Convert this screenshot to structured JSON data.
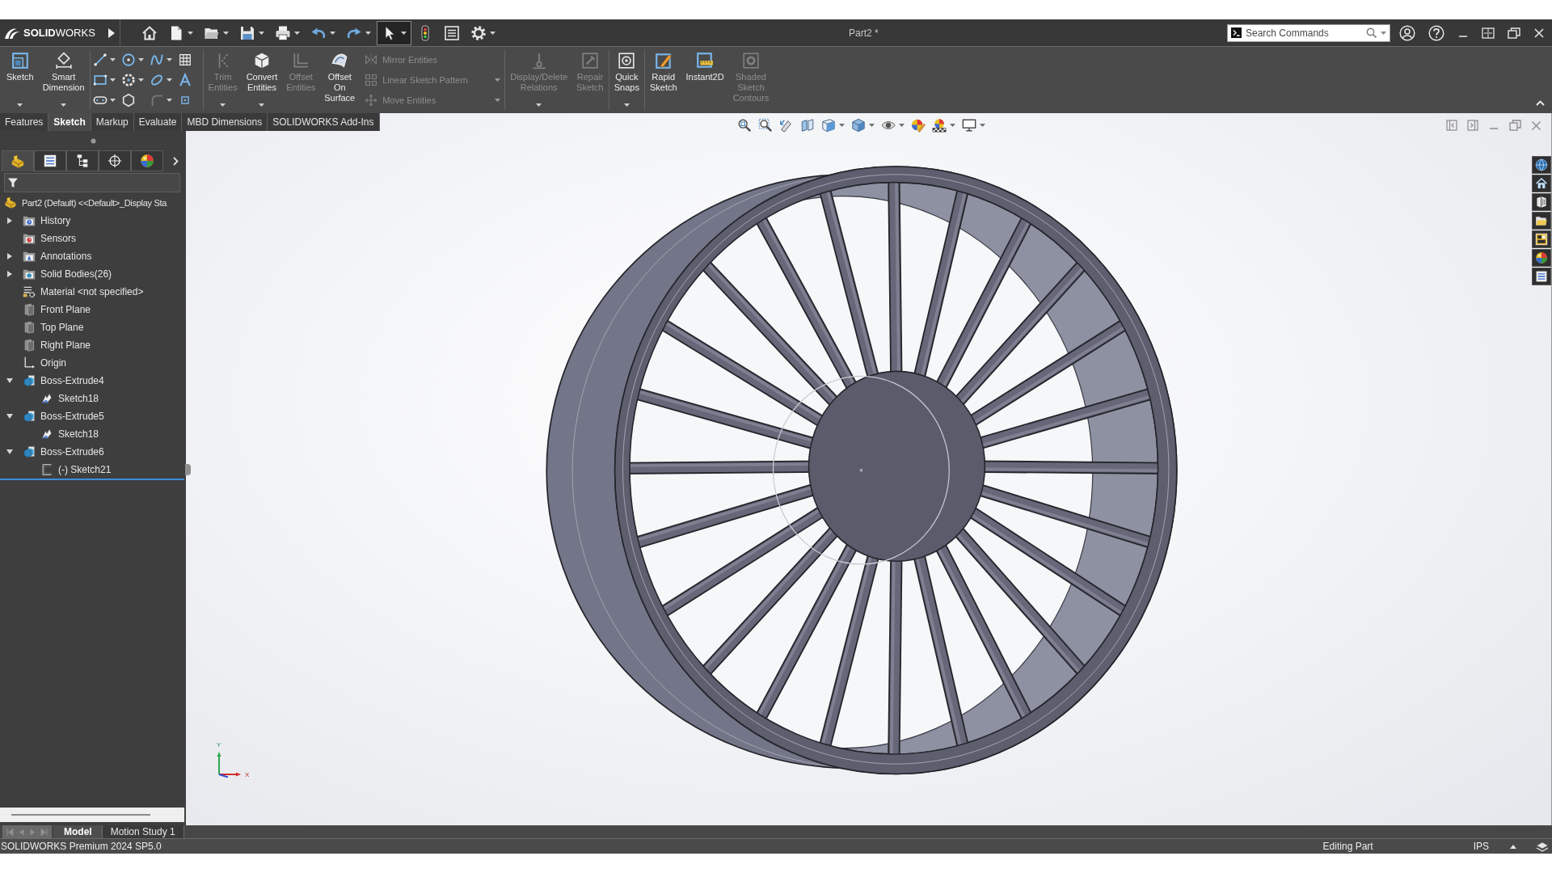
{
  "title_bar": {
    "logo": "**SOLID**WORKS",
    "quick_access": [
      {
        "kind": "home",
        "dropdown": false,
        "pressed": false
      },
      {
        "kind": "new",
        "dropdown": true,
        "pressed": false
      },
      {
        "kind": "open",
        "dropdown": true,
        "pressed": false
      },
      {
        "kind": "save",
        "dropdown": true,
        "pressed": false
      },
      {
        "kind": "print",
        "dropdown": true,
        "pressed": false
      },
      {
        "kind": "undo",
        "dropdown": true,
        "pressed": false
      },
      {
        "kind": "redo",
        "dropdown": true,
        "pressed": false
      },
      {
        "kind": "select",
        "dropdown": true,
        "pressed": true
      },
      {
        "kind": "rebuild",
        "dropdown": false,
        "pressed": false
      },
      {
        "kind": "properties",
        "dropdown": false,
        "pressed": false
      },
      {
        "kind": "options",
        "dropdown": true,
        "pressed": false
      }
    ],
    "document_title": "Part2 *",
    "search": {
      "placeholder": "Search Commands"
    }
  },
  "ribbon": {
    "sections": [
      {
        "groups": [
          {
            "kind": "large",
            "tools": [
              {
                "kind": "sketch",
                "label": "Sketch",
                "enabled": true,
                "dropdown": true
              },
              {
                "kind": "dimension",
                "label": "Smart Dimension",
                "enabled": true,
                "dropdown": true
              }
            ]
          }
        ]
      },
      {
        "groups": [
          {
            "kind": "grid",
            "tools": [
              {
                "kind": "line",
                "enabled": true,
                "dropdown": true
              },
              {
                "kind": "circle",
                "enabled": true,
                "dropdown": true
              },
              {
                "kind": "spline",
                "enabled": true,
                "dropdown": true
              },
              {
                "kind": "mesh",
                "enabled": true,
                "dropdown": false
              },
              {
                "kind": "rectangle",
                "enabled": true,
                "dropdown": true
              },
              {
                "kind": "arc",
                "enabled": true,
                "dropdown": true
              },
              {
                "kind": "ellipse",
                "enabled": true,
                "dropdown": true
              },
              {
                "kind": "text",
                "enabled": true,
                "dropdown": false
              },
              {
                "kind": "slot",
                "enabled": true,
                "dropdown": true
              },
              {
                "kind": "polygon",
                "enabled": true,
                "dropdown": false
              },
              {
                "kind": "fillet",
                "enabled": false,
                "dropdown": true
              },
              {
                "kind": "point",
                "enabled": true,
                "dropdown": false
              }
            ]
          }
        ]
      },
      {
        "groups": [
          {
            "kind": "large",
            "tools": [
              {
                "kind": "trim",
                "label": "Trim Entities",
                "enabled": false,
                "dropdown": true
              },
              {
                "kind": "convert",
                "label": "Convert Entities",
                "enabled": true,
                "dropdown": true
              },
              {
                "kind": "offset",
                "label": "Offset Entities",
                "enabled": false,
                "dropdown": false
              },
              {
                "kind": "surface",
                "label": "Offset On Surface",
                "enabled": true,
                "dropdown": false
              }
            ]
          },
          {
            "kind": "list",
            "tools": [
              {
                "kind": "mirror",
                "label": "Mirror Entities",
                "enabled": false,
                "dropdown": false
              },
              {
                "kind": "pattern",
                "label": "Linear Sketch Pattern",
                "enabled": false,
                "dropdown": true
              },
              {
                "kind": "move",
                "label": "Move Entities",
                "enabled": false,
                "dropdown": true
              }
            ]
          }
        ]
      },
      {
        "groups": [
          {
            "kind": "large",
            "tools": [
              {
                "kind": "relations",
                "label": "Display/Delete Relations",
                "enabled": false,
                "dropdown": true
              },
              {
                "kind": "repair",
                "label": "Repair Sketch",
                "enabled": false,
                "dropdown": false
              }
            ]
          }
        ]
      },
      {
        "groups": [
          {
            "kind": "large",
            "tools": [
              {
                "kind": "snaps",
                "label": "Quick Snaps",
                "enabled": true,
                "dropdown": true
              }
            ]
          }
        ]
      },
      {
        "groups": [
          {
            "kind": "large",
            "tools": [
              {
                "kind": "rapid",
                "label": "Rapid Sketch",
                "enabled": true,
                "dropdown": false
              },
              {
                "kind": "instant",
                "label": "Instant2D",
                "enabled": true,
                "dropdown": false
              },
              {
                "kind": "contours",
                "label": "Shaded Sketch Contours",
                "enabled": false,
                "dropdown": false
              }
            ]
          }
        ]
      }
    ]
  },
  "command_tabs": [
    {
      "label": "Features",
      "selected": false
    },
    {
      "label": "Sketch",
      "selected": true
    },
    {
      "label": "Markup",
      "selected": false
    },
    {
      "label": "Evaluate",
      "selected": false
    },
    {
      "label": "MBD Dimensions",
      "selected": false
    },
    {
      "label": "SOLIDWORKS Add-Ins",
      "selected": false
    }
  ],
  "feature_manager": {
    "panel_tabs": [
      {
        "kind": "tree",
        "selected": true
      },
      {
        "kind": "property",
        "selected": false
      },
      {
        "kind": "config",
        "selected": false
      },
      {
        "kind": "dimxpert",
        "selected": false
      },
      {
        "kind": "display",
        "selected": false
      }
    ],
    "tree": [
      {
        "kind": "part",
        "label": "Part2 (Default) <<Default>_Display Sta",
        "children": [
          {
            "kind": "history",
            "label": "History",
            "expanded": false
          },
          {
            "kind": "sensors",
            "label": "Sensors"
          },
          {
            "kind": "annotations",
            "label": "Annotations",
            "expanded": false
          },
          {
            "kind": "bodies",
            "label": "Solid Bodies(26)",
            "expanded": false
          },
          {
            "kind": "material",
            "label": "Material <not specified>"
          },
          {
            "kind": "plane",
            "label": "Front Plane"
          },
          {
            "kind": "plane",
            "label": "Top Plane"
          },
          {
            "kind": "plane",
            "label": "Right Plane"
          },
          {
            "kind": "origin",
            "label": "Origin"
          },
          {
            "kind": "feature",
            "label": "Boss-Extrude4",
            "expanded": true,
            "children": [
              {
                "kind": "sketch",
                "label": "Sketch18"
              }
            ]
          },
          {
            "kind": "feature",
            "label": "Boss-Extrude5",
            "expanded": true,
            "children": [
              {
                "kind": "sketch",
                "label": "Sketch18"
              }
            ]
          },
          {
            "kind": "feature",
            "label": "Boss-Extrude6",
            "expanded": true,
            "children": [
              {
                "kind": "outline",
                "label": "(-) Sketch21"
              }
            ]
          }
        ]
      }
    ]
  },
  "viewport": {
    "triad": {
      "y_label": "Y",
      "x_label": "X"
    }
  },
  "bottom_tabs": [
    {
      "label": "Model",
      "selected": true
    },
    {
      "label": "Motion Study 1",
      "selected": false
    }
  ],
  "status_bar": {
    "product": "SOLIDWORKS Premium 2024 SP5.0",
    "mode": "Editing Part",
    "units": "IPS"
  }
}
